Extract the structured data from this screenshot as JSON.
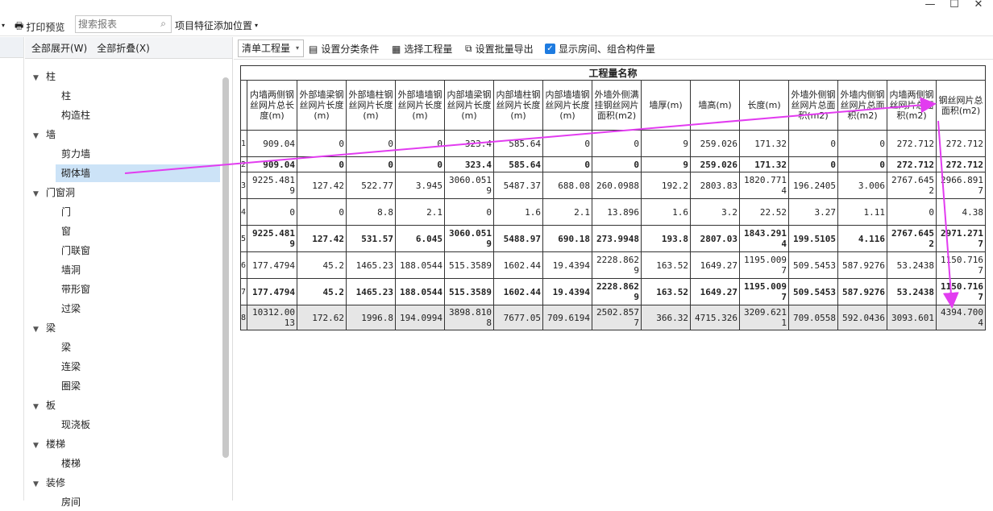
{
  "toolbar": {
    "print_preview": "打印预览",
    "search_placeholder": "搜索报表",
    "add_position": "项目特征添加位置"
  },
  "tree": {
    "expand_all": "全部展开(W)",
    "collapse_all": "全部折叠(X)",
    "nodes": [
      {
        "label": "柱",
        "group": true
      },
      {
        "label": "柱"
      },
      {
        "label": "构造柱"
      },
      {
        "label": "墙",
        "group": true
      },
      {
        "label": "剪力墙"
      },
      {
        "label": "砌体墙",
        "selected": true
      },
      {
        "label": "门窗洞",
        "group": true
      },
      {
        "label": "门"
      },
      {
        "label": "窗"
      },
      {
        "label": "门联窗"
      },
      {
        "label": "墙洞"
      },
      {
        "label": "带形窗"
      },
      {
        "label": "过梁"
      },
      {
        "label": "梁",
        "group": true
      },
      {
        "label": "梁"
      },
      {
        "label": "连梁"
      },
      {
        "label": "圈梁"
      },
      {
        "label": "板",
        "group": true
      },
      {
        "label": "现浇板"
      },
      {
        "label": "楼梯",
        "group": true
      },
      {
        "label": "楼梯"
      },
      {
        "label": "装修",
        "group": true
      },
      {
        "label": "房间"
      }
    ]
  },
  "main_toolbar": {
    "quantity_select": "清单工程量",
    "set_category": "设置分类条件",
    "select_quantity": "选择工程量",
    "batch_export": "设置批量导出",
    "show_rooms": "显示房间、组合构件量"
  },
  "table": {
    "title": "工程量名称",
    "headers": [
      "内墙两侧钢丝网片总长度(m)",
      "外部墙梁钢丝网片长度(m)",
      "外部墙柱钢丝网片长度(m)",
      "外部墙墙钢丝网片长度(m)",
      "内部墙梁钢丝网片长度(m)",
      "内部墙柱钢丝网片长度(m)",
      "内部墙墙钢丝网片长度(m)",
      "外墙外侧满挂钢丝网片面积(m2)",
      "墙厚(m)",
      "墙高(m)",
      "长度(m)",
      "外墙外侧钢丝网片总面积(m2)",
      "外墙内侧钢丝网片总面积(m2)",
      "内墙两侧钢丝网片总面积(m2)",
      "钢丝网片总面积(m2)"
    ],
    "rows": [
      {
        "n": "1",
        "style": "normal",
        "cells": [
          "909.04",
          "0",
          "0",
          "0",
          "323.4",
          "585.64",
          "0",
          "0",
          "9",
          "259.026",
          "171.32",
          "0",
          "0",
          "272.712",
          "272.712"
        ]
      },
      {
        "n": "2",
        "style": "bold",
        "cells": [
          "909.04",
          "0",
          "0",
          "0",
          "323.4",
          "585.64",
          "0",
          "0",
          "9",
          "259.026",
          "171.32",
          "0",
          "0",
          "272.712",
          "272.712"
        ]
      },
      {
        "n": "3",
        "style": "normal",
        "cells": [
          "9225.4819",
          "127.42",
          "522.77",
          "3.945",
          "3060.0519",
          "5487.37",
          "688.08",
          "260.0988",
          "192.2",
          "2803.83",
          "1820.7714",
          "196.2405",
          "3.006",
          "2767.6452",
          "2966.8917"
        ]
      },
      {
        "n": "4",
        "style": "normal",
        "cells": [
          "0",
          "0",
          "8.8",
          "2.1",
          "0",
          "1.6",
          "2.1",
          "13.896",
          "1.6",
          "3.2",
          "22.52",
          "3.27",
          "1.11",
          "0",
          "4.38"
        ]
      },
      {
        "n": "5",
        "style": "bold",
        "cells": [
          "9225.4819",
          "127.42",
          "531.57",
          "6.045",
          "3060.0519",
          "5488.97",
          "690.18",
          "273.9948",
          "193.8",
          "2807.03",
          "1843.2914",
          "199.5105",
          "4.116",
          "2767.6452",
          "2971.2717"
        ]
      },
      {
        "n": "6",
        "style": "normal",
        "cells": [
          "177.4794",
          "45.2",
          "1465.23",
          "188.0544",
          "515.3589",
          "1602.44",
          "19.4394",
          "2228.8629",
          "163.52",
          "1649.27",
          "1195.0097",
          "509.5453",
          "587.9276",
          "53.2438",
          "1150.7167"
        ]
      },
      {
        "n": "7",
        "style": "bold",
        "cells": [
          "177.4794",
          "45.2",
          "1465.23",
          "188.0544",
          "515.3589",
          "1602.44",
          "19.4394",
          "2228.8629",
          "163.52",
          "1649.27",
          "1195.0097",
          "509.5453",
          "587.9276",
          "53.2438",
          "1150.7167"
        ]
      },
      {
        "n": "8",
        "style": "gray",
        "cells": [
          "10312.0013",
          "172.62",
          "1996.8",
          "194.0994",
          "3898.8108",
          "7677.05",
          "709.6194",
          "2502.8577",
          "366.32",
          "4715.326",
          "3209.6211",
          "709.0558",
          "592.0436",
          "3093.601",
          "4394.7004"
        ]
      }
    ]
  },
  "colors": {
    "annotation": "#e23cf0",
    "selected": "#cce3f7",
    "total_row": "#e6e6e6"
  },
  "icons": [
    "print-icon",
    "search-icon",
    "dropdown-icon",
    "category-icon",
    "select-icon",
    "export-icon",
    "checkbox-icon",
    "minimize-icon",
    "maximize-icon",
    "close-icon"
  ]
}
